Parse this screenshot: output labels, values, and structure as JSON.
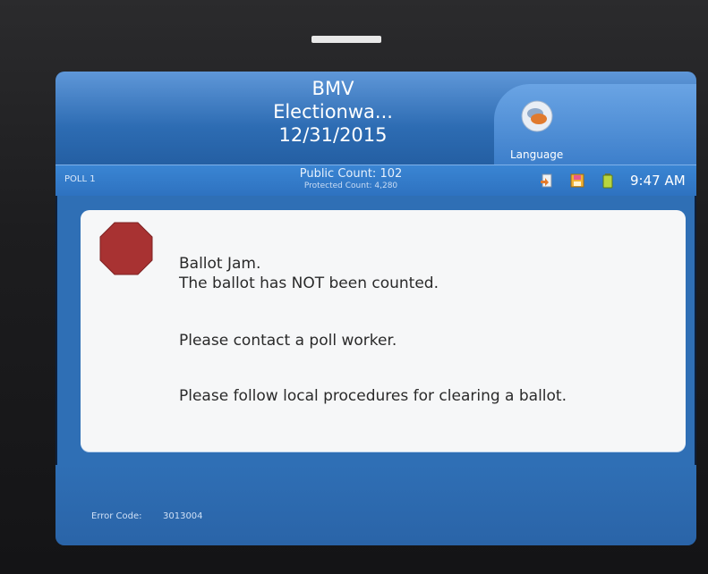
{
  "header": {
    "title_lines": [
      "BMV",
      "Electionwa...",
      "12/31/2015"
    ]
  },
  "language": {
    "label": "Language",
    "icon": "speech-bubbles-icon"
  },
  "status": {
    "poll": "POLL 1",
    "public_count": "Public Count: 102",
    "protected_count": "Protected Count: 4,280",
    "time": "9:47 AM",
    "icons": [
      "document-icon",
      "floppy-disk-icon",
      "battery-icon"
    ]
  },
  "message": {
    "icon": "stop-sign-icon",
    "line1": "Ballot Jam.",
    "line2": "The ballot has NOT been counted.",
    "line3": "Please contact a poll worker.",
    "line4": "Please follow local procedures for clearing a ballot."
  },
  "footer": {
    "error_label": "Error Code:",
    "error_code": "3013004"
  },
  "colors": {
    "screen_blue": "#2f6fb5",
    "panel": "#f6f7f8",
    "stop_red": "#a83232"
  }
}
